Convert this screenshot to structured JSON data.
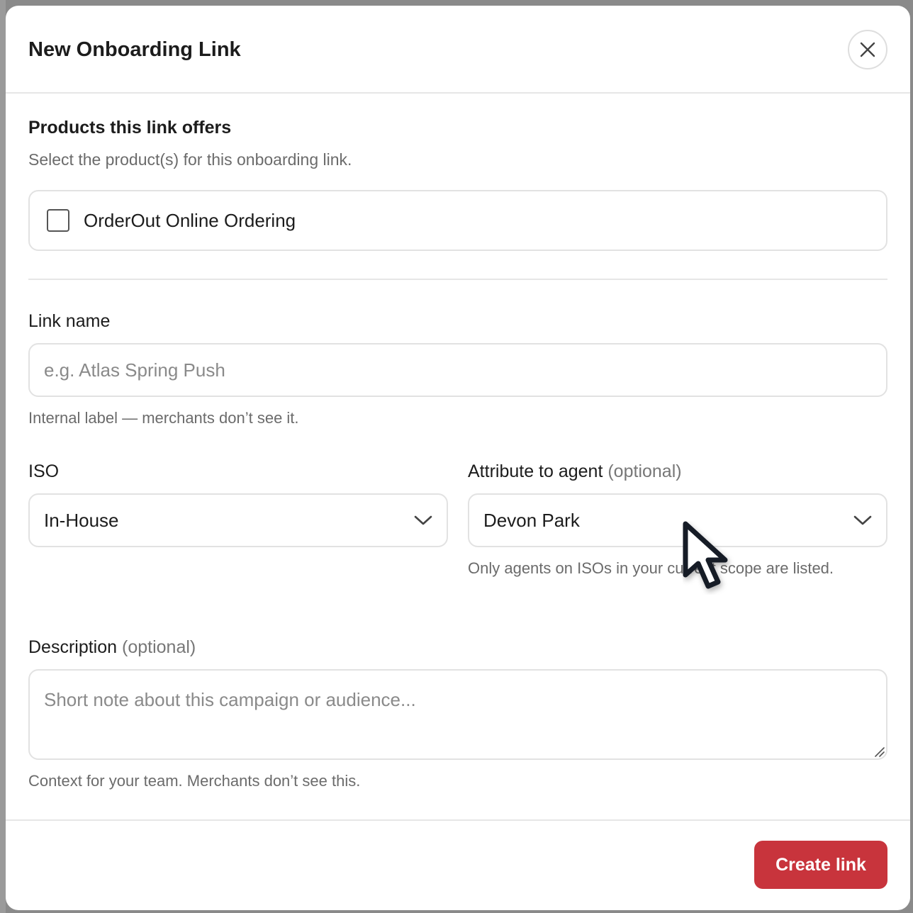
{
  "modal": {
    "title": "New Onboarding Link",
    "close_icon": "close-icon"
  },
  "products": {
    "title": "Products this link offers",
    "subtitle": "Select the product(s) for this onboarding link.",
    "options": [
      {
        "label": "OrderOut Online Ordering",
        "checked": false
      }
    ]
  },
  "link_name": {
    "label": "Link name",
    "value": "",
    "placeholder": "e.g. Atlas Spring Push",
    "help": "Internal label — merchants don’t see it."
  },
  "iso": {
    "label": "ISO",
    "selected": "In-House",
    "icon": "chevron-down-icon"
  },
  "agent": {
    "label": "Attribute to agent",
    "optional": "(optional)",
    "selected": "Devon Park",
    "icon": "chevron-down-icon",
    "help": "Only agents on ISOs in your current scope are listed."
  },
  "description": {
    "label": "Description",
    "optional": "(optional)",
    "value": "",
    "placeholder": "Short note about this campaign or audience...",
    "help": "Context for your team. Merchants don’t see this."
  },
  "footer": {
    "create_label": "Create link"
  },
  "colors": {
    "primary": "#c8343c",
    "border": "#e2e2e2",
    "muted_text": "#6b6b6b"
  }
}
